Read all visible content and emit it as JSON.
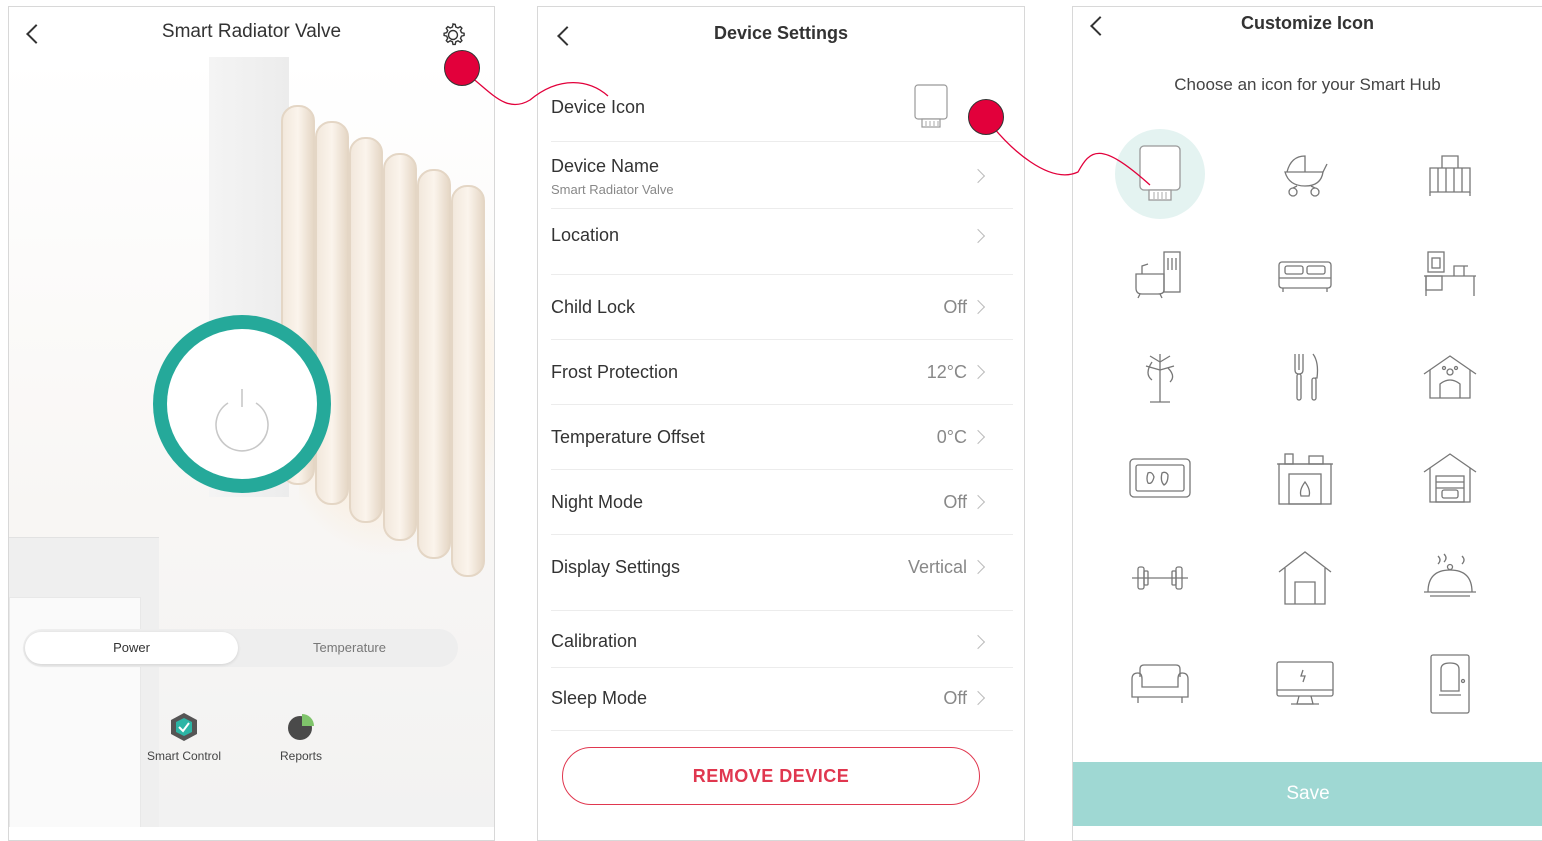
{
  "screen1": {
    "title": "Smart Radiator Valve",
    "segments": [
      "Power",
      "Temperature"
    ],
    "active_segment": "Power",
    "shortcuts": [
      {
        "label": "Smart Control",
        "icon": "smart-control-icon"
      },
      {
        "label": "Reports",
        "icon": "reports-pie-icon"
      }
    ],
    "accent_color": "#25a99a"
  },
  "screen2": {
    "title": "Device Settings",
    "rows": [
      {
        "label": "Device Icon",
        "value": "",
        "icon": "radiator-valve-icon"
      },
      {
        "label": "Device Name",
        "sub": "Smart Radiator Valve",
        "value": ""
      },
      {
        "label": "Location",
        "value": ""
      },
      {
        "label": "Child Lock",
        "value": "Off"
      },
      {
        "label": "Frost Protection",
        "value": "12°C"
      },
      {
        "label": "Temperature Offset",
        "value": "0°C"
      },
      {
        "label": "Night Mode",
        "value": "Off"
      },
      {
        "label": "Display Settings",
        "value": "Vertical"
      },
      {
        "label": "Calibration",
        "value": ""
      },
      {
        "label": "Sleep Mode",
        "value": "Off"
      }
    ],
    "remove_label": "REMOVE DEVICE",
    "danger_color": "#e0374f"
  },
  "screen3": {
    "title": "Customize Icon",
    "subtitle": "Choose an icon for your Smart Hub",
    "icons": [
      "radiator-valve-icon",
      "baby-stroller-icon",
      "crib-icon",
      "bathtub-icon",
      "bed-icon",
      "desk-icon",
      "coat-rack-icon",
      "cutlery-icon",
      "pet-house-icon",
      "doormat-icon",
      "fireplace-icon",
      "garage-icon",
      "dumbbell-icon",
      "doghouse-icon",
      "food-cloche-icon",
      "sofa-icon",
      "monitor-icon",
      "door-icon"
    ],
    "selected_icon": "radiator-valve-icon",
    "save_label": "Save",
    "save_color": "#9fd8d3"
  },
  "annotations": {
    "marker_color": "#e2003b"
  }
}
